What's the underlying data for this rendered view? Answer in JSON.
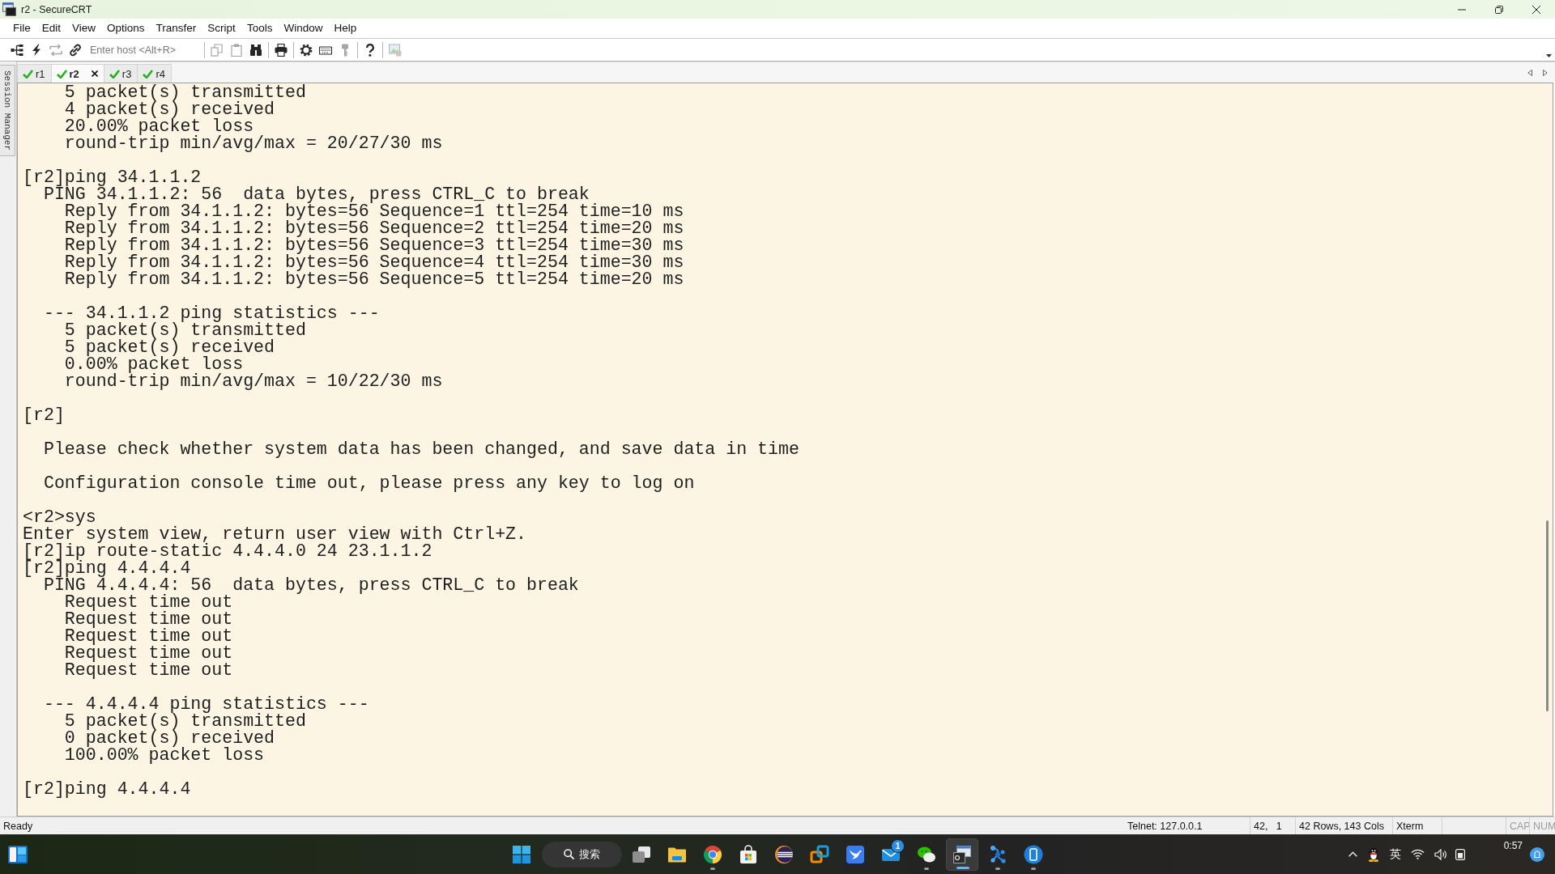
{
  "window": {
    "title": "r2 - SecureCRT"
  },
  "menu": [
    "File",
    "Edit",
    "View",
    "Options",
    "Transfer",
    "Script",
    "Tools",
    "Window",
    "Help"
  ],
  "toolbar": {
    "groups": [
      [
        {
          "kind": "sessions",
          "disabled": false
        },
        {
          "kind": "lightning",
          "disabled": false
        },
        {
          "kind": "reconnect",
          "disabled": true
        },
        {
          "kind": "link",
          "disabled": false
        },
        {
          "kind": "host",
          "placeholder": "Enter host <Alt+R>"
        }
      ],
      [
        {
          "kind": "copy",
          "disabled": true
        },
        {
          "kind": "paste",
          "disabled": true
        },
        {
          "kind": "find",
          "disabled": false
        }
      ],
      [
        {
          "kind": "print",
          "disabled": false
        }
      ],
      [
        {
          "kind": "settings",
          "disabled": false
        },
        {
          "kind": "keymap",
          "disabled": false
        },
        {
          "kind": "key",
          "disabled": true
        }
      ],
      [
        {
          "kind": "help",
          "disabled": false
        }
      ],
      [
        {
          "kind": "image",
          "disabled": true
        }
      ]
    ]
  },
  "session_manager": {
    "label": "Session Manager"
  },
  "tabs": [
    {
      "label": "r1",
      "connected": true,
      "selected": false
    },
    {
      "label": "r2",
      "connected": true,
      "selected": true
    },
    {
      "label": "r3",
      "connected": true,
      "selected": false
    },
    {
      "label": "r4",
      "connected": true,
      "selected": false
    }
  ],
  "terminal": {
    "blocks": [
      [
        "    5 packet(s) transmitted",
        "    4 packet(s) received",
        "    20.00% packet loss",
        "    round-trip min/avg/max = 20/27/30 ms"
      ],
      [
        "[r2]ping 34.1.1.2",
        "  PING 34.1.1.2: 56  data bytes, press CTRL_C to break",
        "    Reply from 34.1.1.2: bytes=56 Sequence=1 ttl=254 time=10 ms",
        "    Reply from 34.1.1.2: bytes=56 Sequence=2 ttl=254 time=20 ms",
        "    Reply from 34.1.1.2: bytes=56 Sequence=3 ttl=254 time=30 ms",
        "    Reply from 34.1.1.2: bytes=56 Sequence=4 ttl=254 time=30 ms",
        "    Reply from 34.1.1.2: bytes=56 Sequence=5 ttl=254 time=20 ms"
      ],
      [
        "  --- 34.1.1.2 ping statistics ---",
        "    5 packet(s) transmitted",
        "    5 packet(s) received",
        "    0.00% packet loss",
        "    round-trip min/avg/max = 10/22/30 ms"
      ],
      [
        "[r2]"
      ],
      [
        "  Please check whether system data has been changed, and save data in time"
      ],
      [
        "  Configuration console time out, please press any key to log on"
      ],
      [
        "<r2>sys",
        "Enter system view, return user view with Ctrl+Z.",
        "[r2]ip route-static 4.4.4.0 24 23.1.1.2",
        "[r2]ping 4.4.4.4",
        "  PING 4.4.4.4: 56  data bytes, press CTRL_C to break",
        "    Request time out",
        "    Request time out",
        "    Request time out",
        "    Request time out",
        "    Request time out"
      ],
      [
        "  --- 4.4.4.4 ping statistics ---",
        "    5 packet(s) transmitted",
        "    0 packet(s) received",
        "    100.00% packet loss"
      ],
      [
        "[r2]ping 4.4.4.4"
      ]
    ]
  },
  "status_bar": {
    "message": "Ready",
    "panes": [
      "Telnet: 127.0.0.1",
      "42,   1",
      "42 Rows, 143 Cols",
      "Xterm"
    ],
    "indicators": [
      {
        "label": "CAP",
        "on": false
      },
      {
        "label": "NUM",
        "on": false
      }
    ]
  },
  "taskbar": {
    "search": {
      "label": "搜索"
    },
    "apps": [
      {
        "kind": "taskview",
        "running": false,
        "selected": false
      },
      {
        "kind": "explorer",
        "running": false,
        "selected": false
      },
      {
        "kind": "browser",
        "running": true,
        "selected": false
      },
      {
        "kind": "store",
        "running": false,
        "selected": false
      },
      {
        "kind": "ide",
        "running": false,
        "selected": false
      },
      {
        "kind": "vm",
        "running": false,
        "selected": false
      },
      {
        "kind": "bird",
        "running": false,
        "selected": false
      },
      {
        "kind": "mail",
        "running": false,
        "selected": false,
        "badge": "1"
      },
      {
        "kind": "chat",
        "running": true,
        "selected": false
      },
      {
        "kind": "terminal",
        "running": true,
        "selected": true
      },
      {
        "kind": "network",
        "running": true,
        "selected": false
      },
      {
        "kind": "phone",
        "running": true,
        "selected": false
      }
    ],
    "tray": {
      "ime": "英",
      "time": "0:57"
    }
  }
}
